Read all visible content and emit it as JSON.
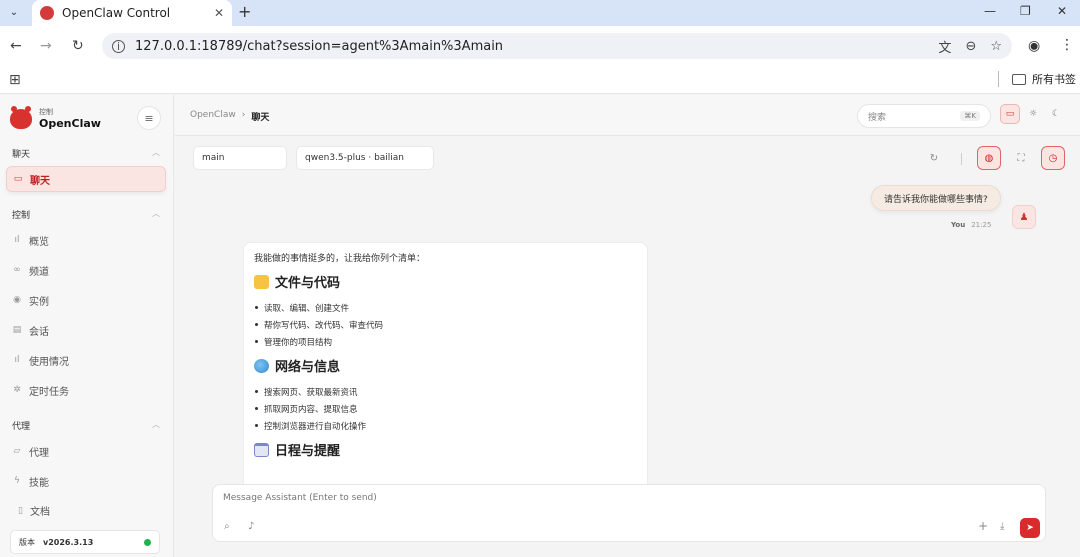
{
  "browser": {
    "tab_title": "OpenClaw Control",
    "url": "127.0.0.1:18789/chat?session=agent%3Amain%3Amain",
    "bookmarks_folder": "所有书签"
  },
  "sidebar": {
    "brand_sub": "控制",
    "brand_name": "OpenClaw",
    "sections": [
      {
        "title": "聊天",
        "items": [
          {
            "label": "聊天",
            "icon": "message-icon",
            "active": true
          }
        ]
      },
      {
        "title": "控制",
        "items": [
          {
            "label": "概览",
            "icon": "bar-chart-icon"
          },
          {
            "label": "频道",
            "icon": "link-icon"
          },
          {
            "label": "实例",
            "icon": "radio-icon"
          },
          {
            "label": "会话",
            "icon": "document-icon"
          },
          {
            "label": "使用情况",
            "icon": "bar-chart-icon"
          },
          {
            "label": "定时任务",
            "icon": "loader-icon"
          }
        ]
      },
      {
        "title": "代理",
        "items": [
          {
            "label": "代理",
            "icon": "folder-icon"
          },
          {
            "label": "技能",
            "icon": "zap-icon"
          }
        ]
      }
    ],
    "docs_label": "文档",
    "version_label": "版本",
    "version_value": "v2026.3.13",
    "status_color": "#22b14c"
  },
  "topbar": {
    "breadcrumb_root": "OpenClaw",
    "breadcrumb_sep": "›",
    "breadcrumb_current": "聊天",
    "search_placeholder": "搜索",
    "search_shortcut": "⌘K"
  },
  "chat": {
    "session_pill": "main",
    "model_pill": "qwen3.5-plus · bailian",
    "user_message": "请告诉我你能做哪些事情?",
    "user_name": "You",
    "user_time": "21:25",
    "assistant": {
      "intro": "我能做的事情挺多的，让我给你列个清单：",
      "sections": [
        {
          "title": "文件与代码",
          "icon": "folder-emoji-icon",
          "items": [
            "读取、编辑、创建文件",
            "帮你写代码、改代码、审查代码",
            "管理你的项目结构"
          ]
        },
        {
          "title": "网络与信息",
          "icon": "globe-emoji-icon",
          "items": [
            "搜索网页、获取最新资讯",
            "抓取网页内容、提取信息",
            "控制浏览器进行自动化操作"
          ]
        },
        {
          "title": "日程与提醒",
          "icon": "calendar-emoji-icon",
          "items": []
        }
      ]
    },
    "composer_placeholder": "Message Assistant (Enter to send)"
  },
  "colors": {
    "accent": "#d92b2b",
    "accent_soft": "#fbe5e3"
  }
}
